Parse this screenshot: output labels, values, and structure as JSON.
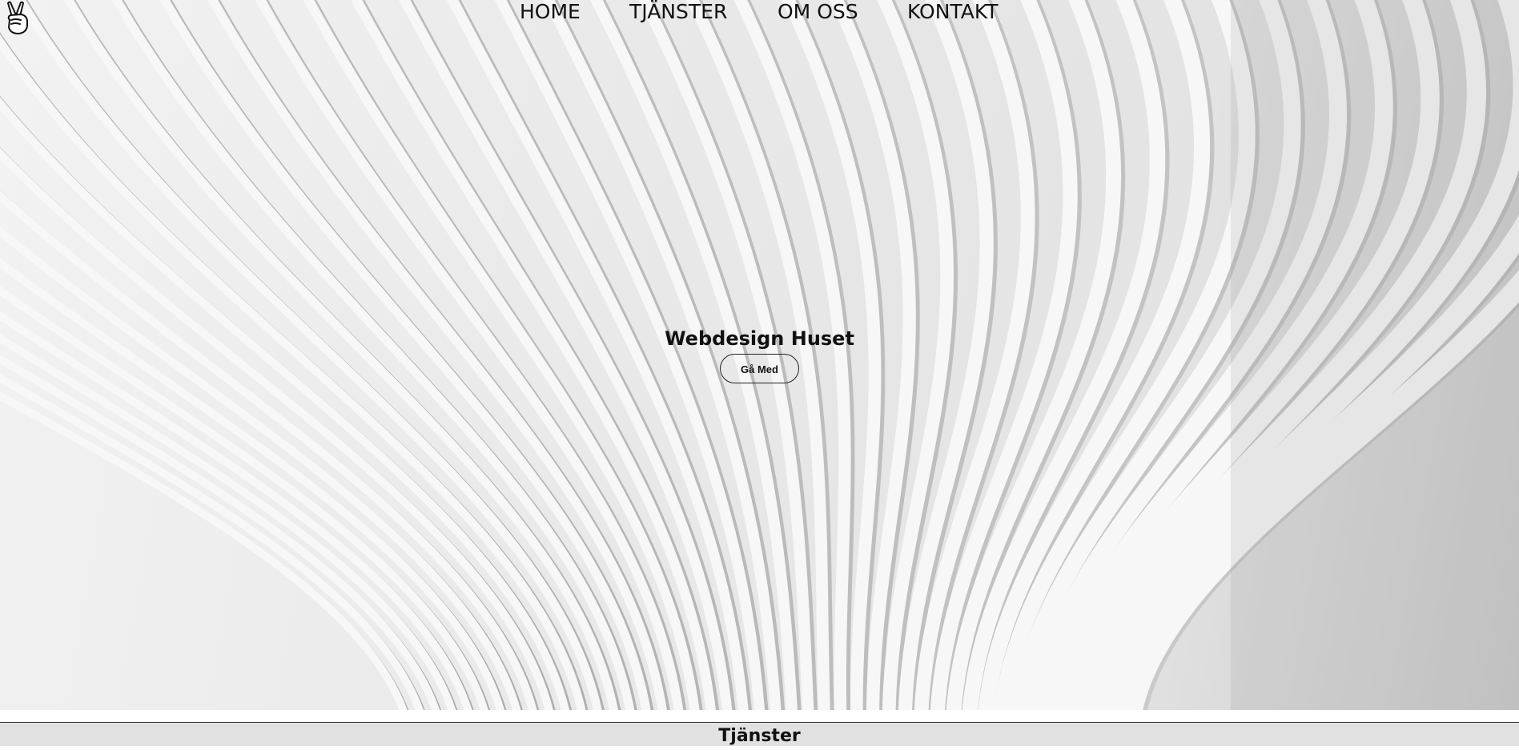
{
  "nav": {
    "items": [
      {
        "label": "HOME"
      },
      {
        "label": "TJÄNSTER"
      },
      {
        "label": "OM OSS"
      },
      {
        "label": "KONTAKT"
      }
    ]
  },
  "logo": {
    "icon": "peace-hand-icon"
  },
  "hero": {
    "title": "Webdesign Huset",
    "cta_label": "Gå Med",
    "background": "white architectural ribs photo"
  },
  "section": {
    "title": "Tjänster"
  },
  "colors": {
    "text": "#111111",
    "section_bg": "#e1e1e1",
    "page_bg": "#ffffff"
  }
}
